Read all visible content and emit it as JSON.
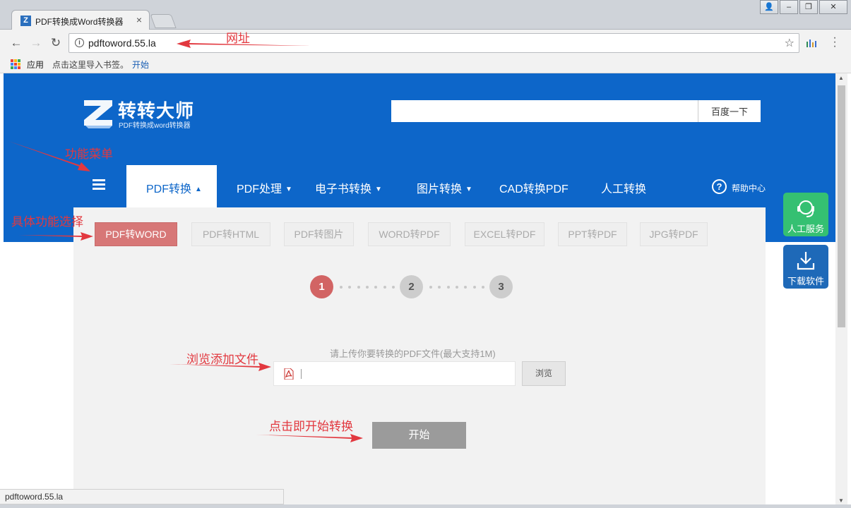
{
  "browser": {
    "tab_title": "PDF转换成Word转换器",
    "url": "pdftoword.55.la",
    "bookmarks_apps": "应用",
    "bookmarks_hint": "点击这里导入书签。",
    "bookmarks_start": "开始",
    "status_url": "pdftoword.55.la"
  },
  "site": {
    "brand": "转转大师",
    "brand_sub": "PDF转换成word转换器",
    "search_button": "百度一下",
    "nav": [
      {
        "label": "PDF转换",
        "active": true
      },
      {
        "label": "PDF处理"
      },
      {
        "label": "电子书转换"
      },
      {
        "label": "图片转换"
      },
      {
        "label": "CAD转换PDF"
      },
      {
        "label": "人工转换"
      }
    ],
    "help": "帮助中心",
    "sub_tabs": [
      "PDF转WORD",
      "PDF转HTML",
      "PDF转图片",
      "WORD转PDF",
      "EXCEL转PDF",
      "PPT转PDF",
      "JPG转PDF"
    ],
    "steps": [
      "1",
      "2",
      "3"
    ],
    "upload_hint": "请上传你要转换的PDF文件(最大支持1M)",
    "browse_button": "浏览",
    "start_button": "开始",
    "float_service": "人工服务",
    "float_download": "下载软件"
  },
  "annotations": {
    "url_note": "网址",
    "menu_note": "功能菜单",
    "feature_note": "具体功能选择",
    "browse_note": "浏览添加文件",
    "start_note": "点击即开始转换"
  },
  "colors": {
    "brand_blue": "#0d66c9",
    "active_tab_red": "#d77777",
    "annotation_red": "#e2383f",
    "service_green": "#35c072"
  }
}
